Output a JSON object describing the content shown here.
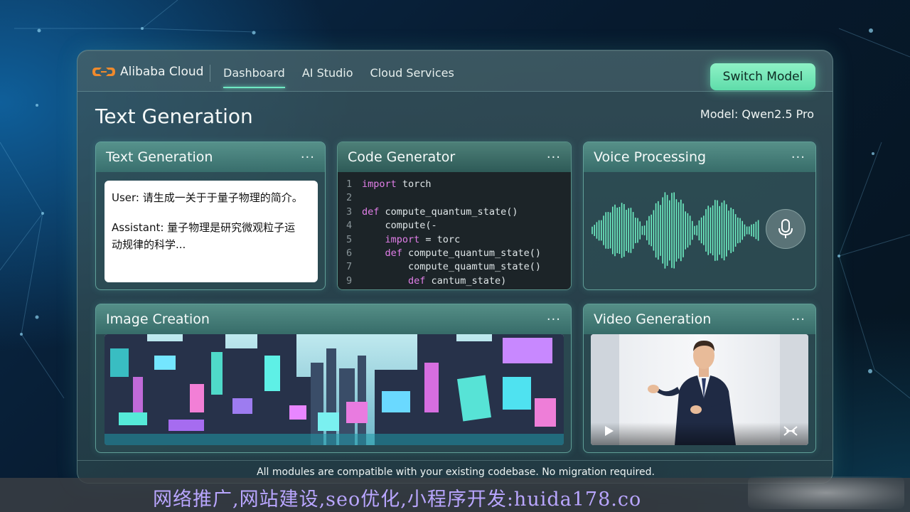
{
  "header": {
    "brand": "Alibaba Cloud",
    "nav": [
      {
        "label": "Dashboard",
        "active": true
      },
      {
        "label": "AI Studio",
        "active": false
      },
      {
        "label": "Cloud Services",
        "active": false
      }
    ],
    "switch_button": "Switch Model"
  },
  "page": {
    "title": "Text Generation",
    "model": "Model: Qwen2.5 Pro"
  },
  "cards": {
    "text": {
      "title": "Text Generation",
      "menu": "···",
      "user_msg": "User: 请生成一关于于量子物理的简介。",
      "assistant_msg_1": "Assistant: 量子物理是研究微观粒子运",
      "assistant_msg_2": "动规律的科学..."
    },
    "code": {
      "title": "Code Generator",
      "menu": "···",
      "lines": [
        {
          "n": "1",
          "kw": "import",
          "rest": " torch",
          "indent": ""
        },
        {
          "n": "2",
          "kw": "",
          "rest": "",
          "indent": ""
        },
        {
          "n": "3",
          "kw": "def",
          "rest": " compute_quantum_state()",
          "indent": ""
        },
        {
          "n": "4",
          "kw": "",
          "rest": "compute(-",
          "indent": "    "
        },
        {
          "n": "5",
          "kw": "import",
          "rest": " = torc",
          "indent": "    "
        },
        {
          "n": "6",
          "kw": "def",
          "rest": " compute_quantum_state()",
          "indent": "    "
        },
        {
          "n": "7",
          "kw": "",
          "rest": "compute_quamtum_state()",
          "indent": "        "
        },
        {
          "n": "9",
          "kw": "def",
          "rest": " cantum_state)",
          "indent": "        "
        }
      ]
    },
    "voice": {
      "title": "Voice Processing",
      "menu": "···",
      "icon": "microphone-icon"
    },
    "image": {
      "title": "Image Creation",
      "menu": "···"
    },
    "video": {
      "title": "Video Generation",
      "menu": "···",
      "play_icon": "play-icon",
      "fullscreen_icon": "fullscreen-icon"
    }
  },
  "footer": "All modules are compatible with your existing codebase. No migration required.",
  "watermark": "网络推广,网站建设,seo优化,小程序开发:huida178.co",
  "colors": {
    "accent": "#6fe8c3",
    "button": "#7eeabb",
    "keyword": "#e27fe9",
    "watermark": "#b9a6ff"
  }
}
